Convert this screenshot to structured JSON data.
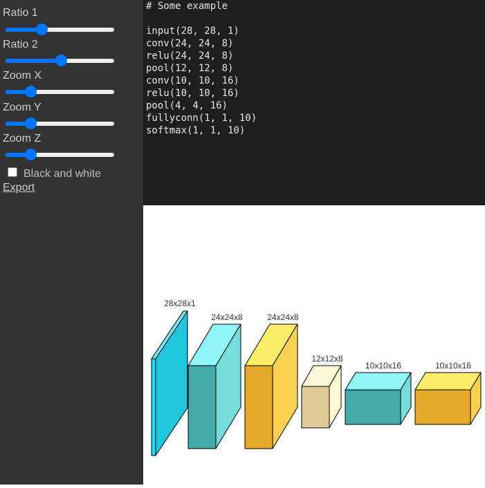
{
  "controls": {
    "ratio1": {
      "label": "Ratio 1",
      "value": 0.33
    },
    "ratio2": {
      "label": "Ratio 2",
      "value": 0.51
    },
    "zoom_x": {
      "label": "Zoom X",
      "value": 0.23
    },
    "zoom_y": {
      "label": "Zoom Y",
      "value": 0.23
    },
    "zoom_z": {
      "label": "Zoom Z",
      "value": 0.23
    },
    "black_and_white": {
      "label": "Black and white",
      "checked": false
    },
    "export_label": "Export"
  },
  "editor": {
    "lines": [
      "# Some example",
      "",
      "input(28, 28, 1)",
      "conv(24, 24, 8)",
      "relu(24, 24, 8)",
      "pool(12, 12, 8)",
      "conv(10, 10, 16)",
      "relu(10, 10, 16)",
      "pool(4, 4, 16)",
      "fullyconn(1, 1, 10)",
      "softmax(1, 1, 10)"
    ]
  },
  "diagram": {
    "layers": [
      {
        "dims": "28x28x1",
        "type": "input",
        "front": "#1edcf8",
        "top": "#79e6f6",
        "side": "#1ec6e0"
      },
      {
        "dims": "24x24x8",
        "type": "conv",
        "front": "#43a9aa",
        "top": "#90f5f8",
        "side": "#74dcdd"
      },
      {
        "dims": "24x24x8",
        "type": "relu",
        "front": "#e7a92a",
        "top": "#fcec6a",
        "side": "#fdd150"
      },
      {
        "dims": "12x12x8",
        "type": "pool",
        "front": "#e1cc99",
        "top": "#fcf8d5",
        "side": "#fefbd3"
      },
      {
        "dims": "10x10x16",
        "type": "conv",
        "front": "#43a9aa",
        "top": "#90f5f8",
        "side": "#74dcdd"
      },
      {
        "dims": "10x10x16",
        "type": "relu",
        "front": "#e7a92a",
        "top": "#fcec6a",
        "side": "#fdd150"
      }
    ]
  }
}
